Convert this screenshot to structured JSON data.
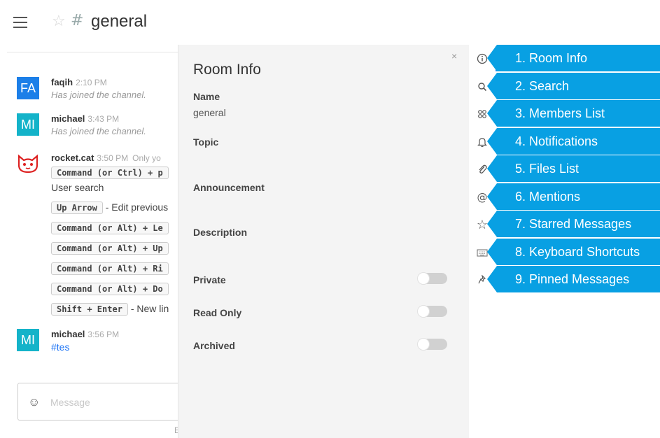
{
  "header": {
    "room_name": "general"
  },
  "messages": [
    {
      "avatar": "FA",
      "user": "faqih",
      "time": "2:10 PM",
      "body": "Has joined the channel."
    },
    {
      "avatar": "MI",
      "user": "michael",
      "time": "3:43 PM",
      "body": "Has joined the channel."
    },
    {
      "user": "rocket.cat",
      "time": "3:50 PM",
      "extra": "Only yo",
      "lines": [
        {
          "kbd": "Command (or Ctrl) + p",
          "text": ""
        },
        {
          "kbd": "",
          "text": "User search"
        },
        {
          "kbd": "Up Arrow",
          "text": "- Edit previous"
        },
        {
          "kbd": "Command (or Alt) + Le",
          "text": ""
        },
        {
          "kbd": "Command (or Alt) + Up",
          "text": ""
        },
        {
          "kbd": "Command (or Alt) + Ri",
          "text": ""
        },
        {
          "kbd": "Command (or Alt) + Do",
          "text": ""
        },
        {
          "kbd": "Shift + Enter",
          "text": "- New lin"
        }
      ]
    },
    {
      "avatar": "MI",
      "user": "michael",
      "time": "3:56 PM",
      "body": "#tes"
    }
  ],
  "composer": {
    "placeholder": "Message",
    "hint": "E"
  },
  "room_info": {
    "title": "Room Info",
    "close": "×",
    "name_label": "Name",
    "name_value": "general",
    "topic_label": "Topic",
    "announcement_label": "Announcement",
    "description_label": "Description",
    "private_label": "Private",
    "read_only_label": "Read Only",
    "archived_label": "Archived",
    "private_on": false,
    "read_only_on": false,
    "archived_on": false
  },
  "toolbar": {
    "icons": [
      "info-icon",
      "search-icon",
      "members-icon",
      "bell-icon",
      "paperclip-icon",
      "at-icon",
      "star-icon",
      "keyboard-icon",
      "pin-icon"
    ]
  },
  "tour": {
    "items": [
      "1. Room Info",
      "2. Search",
      "3. Members List",
      "4. Notifications",
      "5. Files List",
      "6. Mentions",
      "7. Starred Messages",
      "8. Keyboard Shortcuts",
      "9. Pinned Messages"
    ]
  },
  "colors": {
    "accent": "#1d74f5",
    "tour": "#08a0e3",
    "avatar_blue": "#1c7fe8",
    "avatar_teal": "#14b3c9"
  }
}
